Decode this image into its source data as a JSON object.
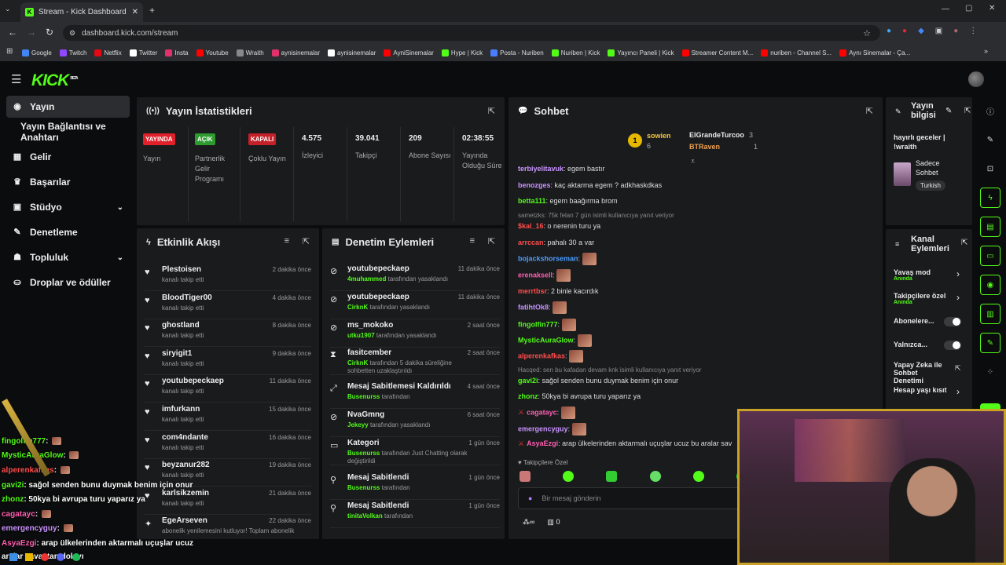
{
  "browser": {
    "tab_title": "Stream - Kick Dashboard",
    "url": "dashboard.kick.com/stream",
    "bookmarks": [
      "Google",
      "Twitch",
      "Netflix",
      "Twitter",
      "Insta",
      "Youtube",
      "Wraith",
      "aynisinemalar",
      "aynisinemalar",
      "AyniSinemalar",
      "Hype | Kick",
      "Posta - Nuriben",
      "Nuriben | Kick",
      "Yayıncı Paneli | Kick",
      "Streamer Content M...",
      "nuriben - Channel S...",
      "Aynı Sinemalar - Ça..."
    ]
  },
  "brand": {
    "logo": "KICK",
    "beta": "BETA"
  },
  "sidebar": {
    "items": [
      {
        "label": "Yayın",
        "icon": "broadcast-icon"
      },
      {
        "label": "Yayın Bağlantısı ve Anahtarı",
        "icon": ""
      },
      {
        "label": "Gelir",
        "icon": "chart-icon"
      },
      {
        "label": "Başarılar",
        "icon": "trophy-icon"
      },
      {
        "label": "Stüdyo",
        "icon": "studio-icon"
      },
      {
        "label": "Denetleme",
        "icon": "wrench-icon"
      },
      {
        "label": "Topluluk",
        "icon": "people-icon"
      },
      {
        "label": "Droplar ve ödüller",
        "icon": "gift-icon"
      }
    ]
  },
  "stats": {
    "title": "Yayın İstatistikleri",
    "cells": [
      {
        "badge": "YAYINDA",
        "label": "Yayın"
      },
      {
        "badge": "AÇIK",
        "label": "Partnerlik Gelir Programı"
      },
      {
        "badge": "KAPALI",
        "label": "Çoklu Yayın"
      },
      {
        "value": "4.575",
        "label": "İzleyici"
      },
      {
        "value": "39.041",
        "label": "Takipçi"
      },
      {
        "value": "209",
        "label": "Abone Sayısı"
      },
      {
        "value": "02:38:55",
        "label": "Yayında Olduğu Süre"
      }
    ]
  },
  "activity": {
    "title": "Etkinlik Akışı",
    "items": [
      {
        "name": "Plestoisen",
        "sub": "kanalı takip etti",
        "time": "2 dakika önce"
      },
      {
        "name": "BloodTiger00",
        "sub": "kanalı takip etti",
        "time": "4 dakika önce"
      },
      {
        "name": "ghostland",
        "sub": "kanalı takip etti",
        "time": "8 dakika önce"
      },
      {
        "name": "siryigit1",
        "sub": "kanalı takip etti",
        "time": "9 dakika önce"
      },
      {
        "name": "youtubepeckaep",
        "sub": "kanalı takip etti",
        "time": "11 dakika önce"
      },
      {
        "name": "imfurkann",
        "sub": "kanalı takip etti",
        "time": "15 dakika önce"
      },
      {
        "name": "com4ndante",
        "sub": "kanalı takip etti",
        "time": "16 dakika önce"
      },
      {
        "name": "beyzanur282",
        "sub": "kanalı takip etti",
        "time": "19 dakika önce"
      },
      {
        "name": "karlsikzemin",
        "sub": "kanalı takip etti",
        "time": "21 dakika önce"
      },
      {
        "name": "EgeArseven",
        "sub": "abonelik yenilemesini kutluyor! Toplam abonelik",
        "time": "22 dakika önce"
      }
    ]
  },
  "moderation": {
    "title": "Denetim Eylemleri",
    "items": [
      {
        "name": "youtubepeckaep",
        "actor": "4muhammed",
        "sub": "tarafından yasaklandı",
        "time": "11 dakika önce"
      },
      {
        "name": "youtubepeckaep",
        "actor": "CirknK",
        "sub": "tarafından yasaklandı",
        "time": "11 dakika önce"
      },
      {
        "name": "ms_mokoko",
        "actor": "utku1907",
        "sub": "tarafından yasaklandı",
        "time": "2 saat önce"
      },
      {
        "name": "fasitcember",
        "actor": "CirknK",
        "sub": "tarafından 5 dakika süreliğine sohbetten uzaklaştırıldı",
        "time": "2 saat önce"
      },
      {
        "name": "Mesaj Sabitlemesi Kaldırıldı",
        "actor": "Busenurss",
        "sub": "tarafından",
        "time": "4 saat önce"
      },
      {
        "name": "NvaGmng",
        "actor": "Jekeyy",
        "sub": "tarafından yasaklandı",
        "time": "6 saat önce"
      },
      {
        "name": "Kategori",
        "actor": "Busenurss",
        "sub": "tarafından Just Chatting olarak değiştirildi",
        "time": "1 gün önce"
      },
      {
        "name": "Mesaj Sabitlendi",
        "actor": "Busenurss",
        "sub": "tarafından",
        "time": "1 gün önce"
      },
      {
        "name": "Mesaj Sabitlendi",
        "actor": "tinitaVolkan",
        "sub": "tarafından",
        "time": "1 gün önce"
      }
    ]
  },
  "chat": {
    "title": "Sohbet",
    "leaderboard": {
      "first": "sowien",
      "first_count": "6",
      "second": "ElGrandeTurcoo",
      "second_count": "3",
      "third": "BTRaven",
      "third_count": "1"
    },
    "messages": [
      {
        "user": "terbiyelitavuk",
        "color": "#c993ff",
        "text": ": egem bastır"
      },
      {
        "user": "benozges",
        "color": "#c993ff",
        "text": ": kaç aktarma egem ? adkhaskdkas"
      },
      {
        "user": "betta111",
        "color": "#53fc18",
        "text": ": egem baağırma brom"
      },
      {
        "user": "",
        "color": "",
        "text": "sametzks: 75k felan 7 gün isimli kullanıcıya yanıt veriyor"
      },
      {
        "user": "$kal_16",
        "color": "#ff4d4d",
        "text": ": o nerenin turu ya"
      },
      {
        "user": "arrccan",
        "color": "#ff4d4d",
        "text": ": pahalı 30 a var"
      },
      {
        "user": "bojackshorseman",
        "color": "#4d9cff",
        "text": ": "
      },
      {
        "user": "erenaksell",
        "color": "#ff5fb0",
        "text": ": "
      },
      {
        "user": "merrtbsr",
        "color": "#ff4d4d",
        "text": ": 2 binle kacırdık"
      },
      {
        "user": "fatihtOk8",
        "color": "#c993ff",
        "text": ": "
      },
      {
        "user": "fingolfin777",
        "color": "#53fc18",
        "text": ": "
      },
      {
        "user": "MysticAuraGlow",
        "color": "#53fc18",
        "text": ": "
      },
      {
        "user": "alperenkafkas",
        "color": "#ff4d4d",
        "text": ": "
      },
      {
        "user": "",
        "color": "",
        "text": "Hacqed: sen bu kafadan devam knk isimli kullanıcıya yanıt veriyor"
      },
      {
        "user": "gavi2i",
        "color": "#53fc18",
        "text": ": sağol senden bunu duymak benim için onur"
      },
      {
        "user": "zhonz",
        "color": "#53fc18",
        "text": ": 50kya bi avrupa turu yaparız ya"
      },
      {
        "user": "cagatayc",
        "color": "#ff5fb0",
        "text": ": "
      },
      {
        "user": "emergencyguy",
        "color": "#c993ff",
        "text": ": "
      },
      {
        "user": "AsyaEzgi",
        "color": "#ff5fb0",
        "text": ": arap ülkelerinden aktarmalı uçuşlar ucuz bu aralar sav"
      }
    ],
    "followers_only": "Takipçilere Özel",
    "input_placeholder": "Bir mesaj gönderin",
    "footer_count": "0"
  },
  "stream_info": {
    "title": "Yayın bilgisi",
    "stream_title": "hayırlı geceler | !wraith",
    "category": "Sadece Sohbet",
    "tag": "Turkish"
  },
  "channel_actions": {
    "title": "Kanal Eylemleri",
    "items": [
      {
        "label": "Yavaş mod",
        "sub": "Anında"
      },
      {
        "label": "Takipçilere özel",
        "sub": "Anında"
      },
      {
        "label": "Abonelere...",
        "sub": ""
      },
      {
        "label": "Yalnızca...",
        "sub": ""
      },
      {
        "label": "Yapay Zeka ile Sohbet Denetimi",
        "sub": ""
      },
      {
        "label": "Hesap yaşı kısıt",
        "sub": ""
      }
    ]
  },
  "overlay_chat": [
    {
      "user": "fingolfin777",
      "text": ": "
    },
    {
      "user": "MysticAuraGlow",
      "text": ": "
    },
    {
      "user": "alperenkafkas",
      "text": ": "
    },
    {
      "user": "gavi2i",
      "text": ": sağol senden bunu duymak benim için onur"
    },
    {
      "user": "zhonz",
      "text": ": 50kya bi avrupa turu yaparız ya"
    },
    {
      "user": "cagatayc",
      "text": ": "
    },
    {
      "user": "emergencyguy",
      "text": ": "
    },
    {
      "user": "AsyaEzgi",
      "text": ": arap ülkelerinden aktarmalı uçuşlar ucuz"
    },
    {
      "user": "",
      "text": "aralar savaştan dolayı"
    }
  ],
  "colors": {
    "accent": "#53fc18",
    "live": "#e0202a",
    "panel": "#191b1d",
    "bg": "#0b0c0d"
  }
}
